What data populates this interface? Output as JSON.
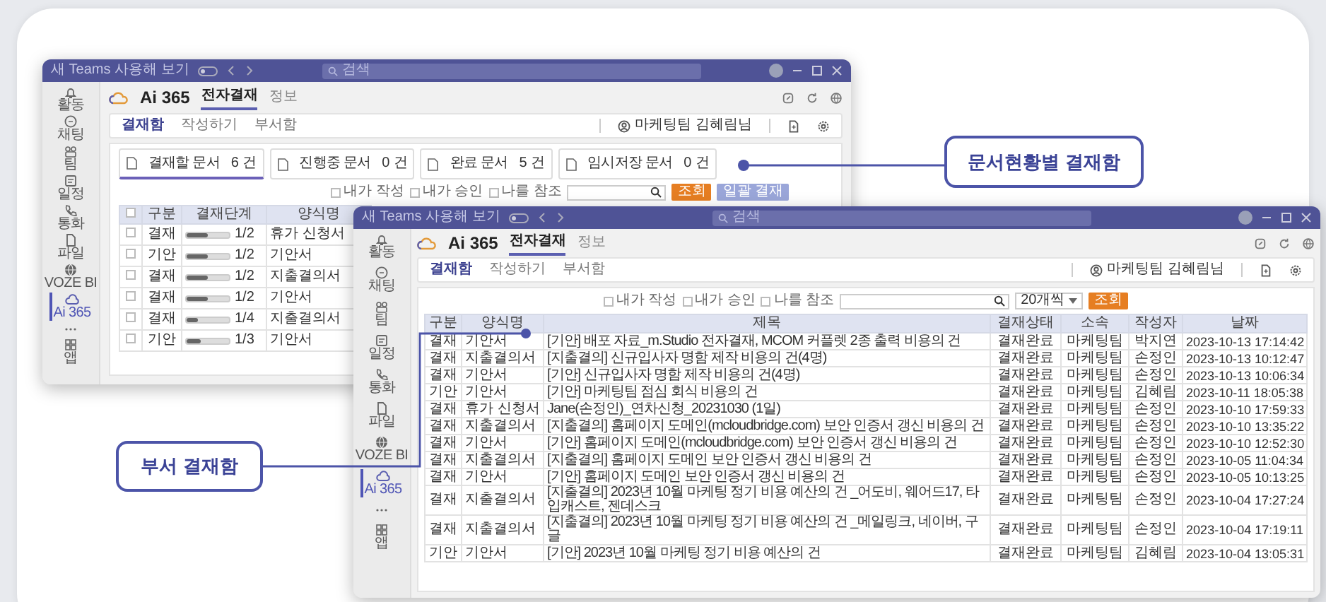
{
  "back_window": {
    "titlebar": {
      "promo": "새 Teams 사용해 보기",
      "toggle_on": false,
      "search_placeholder": "검색"
    },
    "sidebar": [
      {
        "kind": "bell",
        "label": "활동",
        "selected": false
      },
      {
        "kind": "chat",
        "label": "채팅",
        "selected": false
      },
      {
        "kind": "team",
        "label": "팀",
        "selected": false
      },
      {
        "kind": "calendar",
        "label": "일정",
        "selected": false
      },
      {
        "kind": "phone",
        "label": "통화",
        "selected": false
      },
      {
        "kind": "file",
        "label": "파일",
        "selected": false
      },
      {
        "kind": "globe",
        "label": "VOZE BI",
        "selected": false
      },
      {
        "kind": "cloud",
        "label": "Ai 365",
        "selected": true
      },
      {
        "kind": "more",
        "selected": false
      },
      {
        "kind": "apps",
        "label": "앱",
        "selected": false
      }
    ],
    "app": {
      "name": "Ai 365",
      "tabs": [
        {
          "label": "전자결재",
          "selected": true
        },
        {
          "label": "정보",
          "selected": false
        }
      ]
    },
    "subtabs": [
      {
        "label": "결재함",
        "selected": true
      },
      {
        "label": "작성하기",
        "selected": false
      },
      {
        "label": "부서함",
        "selected": false
      }
    ],
    "user": "마케팅팀 김혜림님",
    "cards": [
      {
        "label": "결재할 문서",
        "count": "6 건",
        "selected": true
      },
      {
        "label": "진행중 문서",
        "count": "0 건",
        "selected": false
      },
      {
        "label": "완료 문서",
        "count": "5 건",
        "selected": false
      },
      {
        "label": "임시저장 문서",
        "count": "0 건",
        "selected": false
      }
    ],
    "filters": [
      {
        "label": "내가 작성",
        "checked": false
      },
      {
        "label": "내가 승인",
        "checked": false
      },
      {
        "label": "나를 참조",
        "checked": false
      }
    ],
    "search_button": "조회",
    "approve_button": "일괄 결재",
    "table": {
      "header_checked": false,
      "columns": [
        "구분",
        "결재단계",
        "양식명"
      ],
      "rows": [
        {
          "checked": false,
          "type": "결재",
          "level": 0.5,
          "step": "1/2",
          "form": "휴가 신청서"
        },
        {
          "checked": false,
          "type": "기안",
          "level": 0.5,
          "step": "1/2",
          "form": "기안서"
        },
        {
          "checked": false,
          "type": "결재",
          "level": 0.5,
          "step": "1/2",
          "form": "지출결의서"
        },
        {
          "checked": false,
          "type": "결재",
          "level": 0.5,
          "step": "1/2",
          "form": "기안서"
        },
        {
          "checked": false,
          "type": "결재",
          "level": 0.25,
          "step": "1/4",
          "form": "지출결의서"
        },
        {
          "checked": false,
          "type": "기안",
          "level": 0.33,
          "step": "1/3",
          "form": "기안서"
        }
      ]
    }
  },
  "front_window": {
    "titlebar": {
      "promo": "새 Teams 사용해 보기",
      "toggle_on": false,
      "search_placeholder": "검색"
    },
    "sidebar": [
      {
        "kind": "bell",
        "label": "활동",
        "selected": false
      },
      {
        "kind": "chat",
        "label": "채팅",
        "selected": false
      },
      {
        "kind": "team",
        "label": "팀",
        "selected": false
      },
      {
        "kind": "calendar",
        "label": "일정",
        "selected": false
      },
      {
        "kind": "phone",
        "label": "통화",
        "selected": false
      },
      {
        "kind": "file",
        "label": "파일",
        "selected": false
      },
      {
        "kind": "globe",
        "label": "VOZE BI",
        "selected": false
      },
      {
        "kind": "cloud",
        "label": "Ai 365",
        "selected": true
      },
      {
        "kind": "more",
        "selected": false
      },
      {
        "kind": "apps",
        "label": "앱",
        "selected": false
      }
    ],
    "app": {
      "name": "Ai 365",
      "tabs": [
        {
          "label": "전자결재",
          "selected": true
        },
        {
          "label": "정보",
          "selected": false
        }
      ]
    },
    "subtabs": [
      {
        "label": "결재함",
        "selected": true
      },
      {
        "label": "작성하기",
        "selected": false
      },
      {
        "label": "부서함",
        "selected": false
      }
    ],
    "user": "마케팅팀 김혜림님",
    "filters": [
      {
        "label": "내가 작성",
        "checked": false
      },
      {
        "label": "내가 승인",
        "checked": false
      },
      {
        "label": "나를 참조",
        "checked": false
      }
    ],
    "page_size": "20개씩",
    "search_button": "조회",
    "table": {
      "columns": [
        "구분",
        "양식명",
        "제목",
        "결재상태",
        "소속",
        "작성자",
        "날짜"
      ],
      "rows": [
        [
          "결재",
          "기안서",
          "[기안] 배포 자료_m.Studio 전자결재, MCOM 커플렛 2종 출력 비용의 건",
          "결재완료",
          "마케팅팀",
          "박지연",
          "2023-10-13 17:14:42"
        ],
        [
          "결재",
          "지출결의서",
          "[지출결의] 신규입사자 명함 제작 비용의 건(4명)",
          "결재완료",
          "마케팅팀",
          "손정인",
          "2023-10-13 10:12:47"
        ],
        [
          "결재",
          "기안서",
          "[기안] 신규입사자 명함 제작 비용의 건(4명)",
          "결재완료",
          "마케팅팀",
          "손정인",
          "2023-10-13 10:06:34"
        ],
        [
          "기안",
          "기안서",
          "[기안] 마케팅팀 점심 회식 비용의 건",
          "결재완료",
          "마케팅팀",
          "김혜림",
          "2023-10-11 18:05:38"
        ],
        [
          "결재",
          "휴가 신청서",
          "Jane(손정인)_연차신청_20231030 (1일)",
          "결재완료",
          "마케팅팀",
          "손정인",
          "2023-10-10 17:59:33"
        ],
        [
          "결재",
          "지출결의서",
          "[지출결의] 홈페이지 도메인(mcloudbridge.com) 보안 인증서 갱신 비용의 건",
          "결재완료",
          "마케팅팀",
          "손정인",
          "2023-10-10 13:35:22"
        ],
        [
          "결재",
          "기안서",
          "[기안] 홈페이지 도메인(mcloudbridge.com) 보안 인증서 갱신 비용의 건",
          "결재완료",
          "마케팅팀",
          "손정인",
          "2023-10-10 12:52:30"
        ],
        [
          "결재",
          "지출결의서",
          "[지출결의] 홈페이지 도메인 보안 인증서 갱신 비용의 건",
          "결재완료",
          "마케팅팀",
          "손정인",
          "2023-10-05 11:04:34"
        ],
        [
          "결재",
          "기안서",
          "[기안] 홈페이지 도메인 보안 인증서 갱신 비용의 건",
          "결재완료",
          "마케팅팀",
          "손정인",
          "2023-10-05 10:13:25"
        ],
        [
          "결재",
          "지출결의서",
          "[지출결의] 2023년 10월 마케팅 정기 비용 예산의 건 _어도비, 웨어드17, 타입캐스트, 젠데스크",
          "결재완료",
          "마케팅팀",
          "손정인",
          "2023-10-04 17:27:24"
        ],
        [
          "결재",
          "지출결의서",
          "[지출결의] 2023년 10월 마케팅 정기 비용 예산의 건 _메일링크, 네이버, 구글",
          "결재완료",
          "마케팅팀",
          "손정인",
          "2023-10-04 17:19:11"
        ],
        [
          "기안",
          "기안서",
          "[기안] 2023년 10월 마케팅 정기 비용 예산의 건",
          "결재완료",
          "마케팅팀",
          "김혜림",
          "2023-10-04 13:05:31"
        ]
      ]
    }
  },
  "callouts": [
    {
      "label": "문서현황별 결재함"
    },
    {
      "label": "부서 결재함"
    }
  ]
}
